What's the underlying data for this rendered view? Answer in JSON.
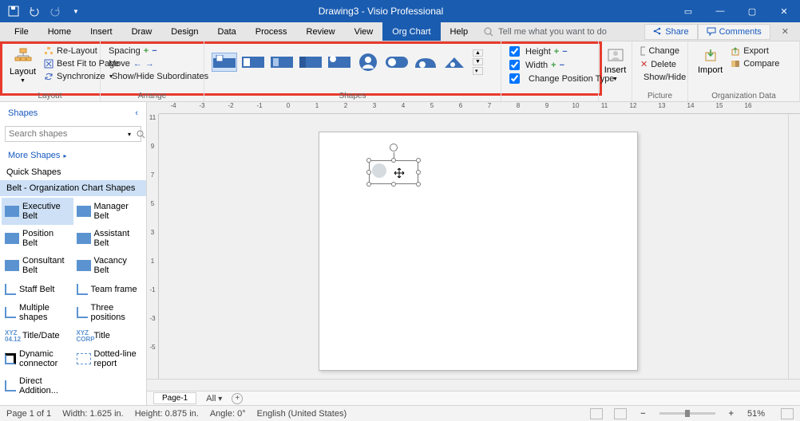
{
  "title": "Drawing3 - Visio Professional",
  "menu": [
    "File",
    "Home",
    "Insert",
    "Draw",
    "Design",
    "Data",
    "Process",
    "Review",
    "View",
    "Org Chart",
    "Help"
  ],
  "activeMenu": "Org Chart",
  "tellme": "Tell me what you want to do",
  "share": "Share",
  "comments": "Comments",
  "ribbon": {
    "layout": {
      "big": "Layout",
      "relayout": "Re-Layout",
      "bestfit": "Best Fit to Page",
      "sync": "Synchronize",
      "label": "Layout"
    },
    "arrange": {
      "spacing": "Spacing",
      "move": "Move",
      "showhide": "Show/Hide Subordinates",
      "label": "Arrange"
    },
    "shapes_label": "Shapes",
    "dim": {
      "height": "Height",
      "width": "Width",
      "cpt": "Change Position Type"
    },
    "insert": "Insert",
    "picture": {
      "change": "Change",
      "delete": "Delete",
      "showhide": "Show/Hide",
      "label": "Picture"
    },
    "orgdata": {
      "import": "Import",
      "export": "Export",
      "compare": "Compare",
      "label": "Organization Data"
    }
  },
  "shapespane": {
    "header": "Shapes",
    "search_ph": "Search shapes",
    "more": "More Shapes",
    "quick": "Quick Shapes",
    "category": "Belt - Organization Chart Shapes",
    "items": [
      "Executive Belt",
      "Manager Belt",
      "Position Belt",
      "Assistant Belt",
      "Consultant Belt",
      "Vacancy Belt",
      "Staff Belt",
      "Team frame",
      "Multiple shapes",
      "Three positions",
      "Title/Date",
      "Title",
      "Dynamic connector",
      "Dotted-line report",
      "Direct Addition..."
    ]
  },
  "hruler": [
    "-4",
    "-3",
    "-2",
    "-1",
    "0",
    "1",
    "2",
    "3",
    "4",
    "5",
    "6",
    "7",
    "8",
    "9",
    "10",
    "11",
    "12",
    "13",
    "14",
    "15",
    "16"
  ],
  "vruler": [
    "11",
    "9",
    "7",
    "5",
    "3",
    "1",
    "-1",
    "-3",
    "-5"
  ],
  "pagetab": "Page-1",
  "all": "All",
  "status": {
    "page": "Page 1 of 1",
    "width": "Width: 1.625 in.",
    "height": "Height: 0.875 in.",
    "angle": "Angle: 0°",
    "lang": "English (United States)",
    "zoom": "51%"
  }
}
